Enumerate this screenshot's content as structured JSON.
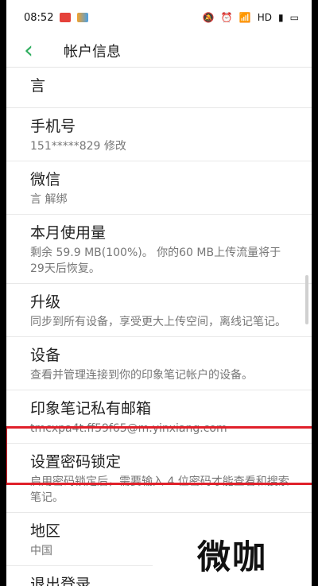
{
  "statusbar": {
    "time": "08:52",
    "network": "HD",
    "icons": [
      "notification-badge-red",
      "app-badge-colored",
      "mute-icon",
      "alarm-icon",
      "wifi-icon",
      "signal-icon",
      "battery-icon"
    ]
  },
  "header": {
    "back_icon": "chevron-left-icon",
    "title": "帐户信息"
  },
  "items": [
    {
      "label": "言",
      "sub": ""
    },
    {
      "label": "手机号",
      "sub": "151*****829  修改"
    },
    {
      "label": "微信",
      "sub": "言  解绑"
    },
    {
      "label": "本月使用量",
      "sub": "剩余 59.9 MB(100%)。 你的60 MB上传流量将于29天后恢复。"
    },
    {
      "label": "升级",
      "sub": "同步到所有设备，享受更大上传空间，离线记笔记。"
    },
    {
      "label": "设备",
      "sub": "查看并管理连接到你的印象笔记帐户的设备。"
    },
    {
      "label": "印象笔记私有邮箱",
      "sub": "tmcxpa4t.ff59f65@m.yinxiang.com"
    },
    {
      "label": "设置密码锁定",
      "sub": "启用密码锁定后，需要输入 4 位密码才能查看和搜索笔记。"
    },
    {
      "label": "地区",
      "sub": "中国"
    },
    {
      "label": "退出登录",
      "sub": ""
    }
  ],
  "watermark": {
    "text": "微咖"
  },
  "colors": {
    "accent": "#2fae5f",
    "highlight": "#e0202a"
  }
}
